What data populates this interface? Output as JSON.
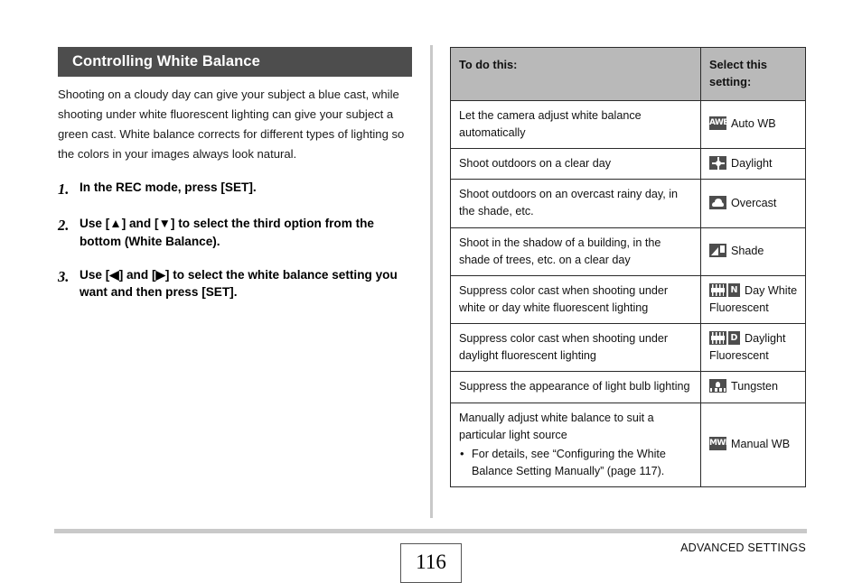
{
  "section": {
    "title": "Controlling White Balance",
    "intro": "Shooting on a cloudy day can give your subject a blue cast, while shooting under white fluorescent lighting can give your subject a green cast. White balance corrects for different types of lighting so the colors in your images always look natural.",
    "steps": [
      {
        "num": "1.",
        "text": "In the REC mode, press [SET]."
      },
      {
        "num": "2.",
        "text": "Use [▲] and [▼] to select the third option from the bottom (White Balance)."
      },
      {
        "num": "3.",
        "text": "Use [◀] and [▶] to select the white balance setting you want and then press [SET]."
      }
    ]
  },
  "table": {
    "headers": {
      "description": "To do this:",
      "setting": "Select this setting:"
    },
    "rows": [
      {
        "description": "Let the camera adjust white balance automatically",
        "icon": "awb-icon",
        "icon_text": "AWB",
        "setting": "Auto WB"
      },
      {
        "description": "Shoot outdoors on a clear day",
        "icon": "sun-icon",
        "icon_text": "",
        "setting": "Daylight"
      },
      {
        "description": "Shoot outdoors on an overcast rainy day, in the shade, etc.",
        "icon": "cloud-icon",
        "icon_text": "",
        "setting": "Overcast"
      },
      {
        "description": "Shoot in the shadow of a building, in the shade of trees, etc. on a clear day",
        "icon": "shade-icon",
        "icon_text": "",
        "setting": "Shade"
      },
      {
        "description": "Suppress color cast when shooting under white or day white fluorescent lighting",
        "icon": "fluorescent-icon",
        "icon_text": "N",
        "setting": "Day White Fluorescent"
      },
      {
        "description": "Suppress color cast when shooting under daylight fluorescent lighting",
        "icon": "fluorescent-icon",
        "icon_text": "D",
        "setting": "Daylight Fluorescent"
      },
      {
        "description": "Suppress the appearance of light bulb lighting",
        "icon": "tungsten-icon",
        "icon_text": "",
        "setting": "Tungsten"
      },
      {
        "description": "Manually adjust white balance to suit a particular light source",
        "note": "For details, see “Configuring the White Balance Setting Manually” (page 117).",
        "icon": "mwb-icon",
        "icon_text": "MWB",
        "setting": "Manual WB"
      }
    ]
  },
  "footer": {
    "page_number": "116",
    "chapter": "ADVANCED SETTINGS"
  },
  "colors": {
    "title_bar": "#4d4d4d",
    "table_header": "#b9b9b9",
    "rule": "#c9c9c9",
    "icon_bg": "#4d4d4d"
  }
}
